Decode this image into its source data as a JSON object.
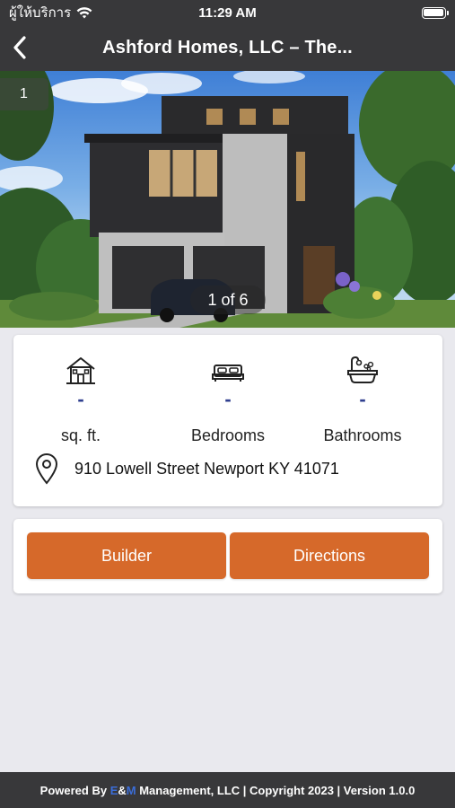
{
  "status_bar": {
    "carrier": "ผู้ให้บริการ",
    "time": "11:29 AM",
    "icons": [
      "wifi-icon",
      "battery-icon"
    ]
  },
  "nav": {
    "back_icon": "chevron-left-icon",
    "title": "Ashford Homes, LLC – The..."
  },
  "gallery": {
    "index_label": "1",
    "counter": "1 of 6"
  },
  "details": {
    "stats": [
      {
        "icon": "house-icon",
        "value": "-",
        "label": "sq. ft."
      },
      {
        "icon": "bed-icon",
        "value": "-",
        "label": "Bedrooms"
      },
      {
        "icon": "bathtub-icon",
        "value": "-",
        "label": "Bathrooms"
      }
    ],
    "address_icon": "location-pin-icon",
    "address": "910 Lowell Street Newport KY 41071"
  },
  "actions": {
    "builder_label": "Builder",
    "directions_label": "Directions"
  },
  "footer": {
    "powered_by": "Powered By ",
    "brand_e": "E",
    "brand_amp": "&",
    "brand_m": "M",
    "rest": " Management, LLC | Copyright 2023 | Version 1.0.0"
  },
  "colors": {
    "bars": "#38383a",
    "accent_button": "#d6692a",
    "stat_value": "#2f3f8f",
    "background": "#e9e9ee"
  }
}
